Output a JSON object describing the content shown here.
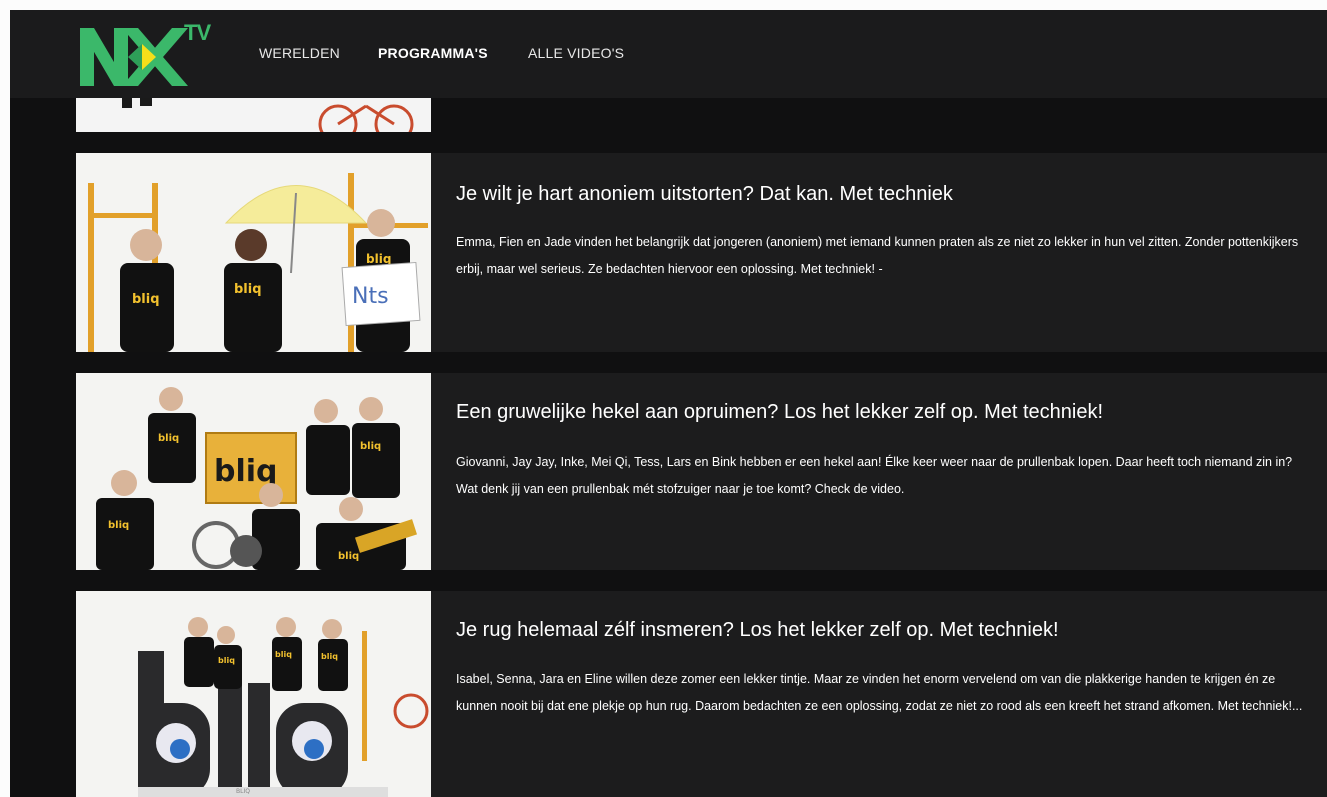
{
  "brand": {
    "logo_text": "NX",
    "logo_suffix": "TV"
  },
  "nav": {
    "items": [
      {
        "label": "WERELDEN",
        "active": false
      },
      {
        "label": "PROGRAMMA'S",
        "active": true
      },
      {
        "label": "ALLE VIDEO'S",
        "active": false
      }
    ]
  },
  "videos": [
    {
      "title": "Je wilt je hart anoniem uitstorten? Dat kan. Met techniek",
      "description": "Emma, Fien en Jade vinden het belangrijk dat jongeren (anoniem) met iemand kunnen praten als ze niet zo lekker in hun vel zitten. Zonder pottenkijkers erbij, maar wel serieus. Ze bedachten hiervoor een oplossing. Met techniek! -",
      "thumb_text": [
        "bliq",
        "bliq",
        "bliq",
        "Nts"
      ]
    },
    {
      "title": "Een gruwelijke hekel aan opruimen? Los het lekker zelf op. Met techniek!",
      "description": "Giovanni, Jay Jay, Inke, Mei Qi, Tess, Lars en Bink hebben er een hekel aan! Élke keer weer naar de prullenbak lopen. Daar heeft toch niemand zin in? Wat denk jij van een prullenbak mét stofzuiger naar je toe komt? Check de video.",
      "thumb_text": [
        "bliq",
        "bliq",
        "bliq",
        "bliq",
        "bliq"
      ]
    },
    {
      "title": "Je rug helemaal zélf insmeren? Los het lekker zelf op. Met techniek!",
      "description": "Isabel, Senna, Jara en Eline willen deze zomer een lekker tintje. Maar ze vinden het enorm vervelend om van die plakkerige handen te krijgen én ze kunnen nooit bij dat ene plekje op hun rug. Daarom bedachten ze een oplossing, zodat ze niet zo rood als een kreeft het strand afkomen. Met techniek!...",
      "thumb_text": [
        "bliq",
        "bliq",
        "bliq",
        "BLIQ"
      ]
    }
  ],
  "colors": {
    "background": "#101011",
    "card": "#1c1c1d",
    "header": "#1b1b1c",
    "logo_green": "#3bb86a",
    "logo_yellow": "#f5df1a",
    "brand_yellow": "#f2c12e"
  }
}
